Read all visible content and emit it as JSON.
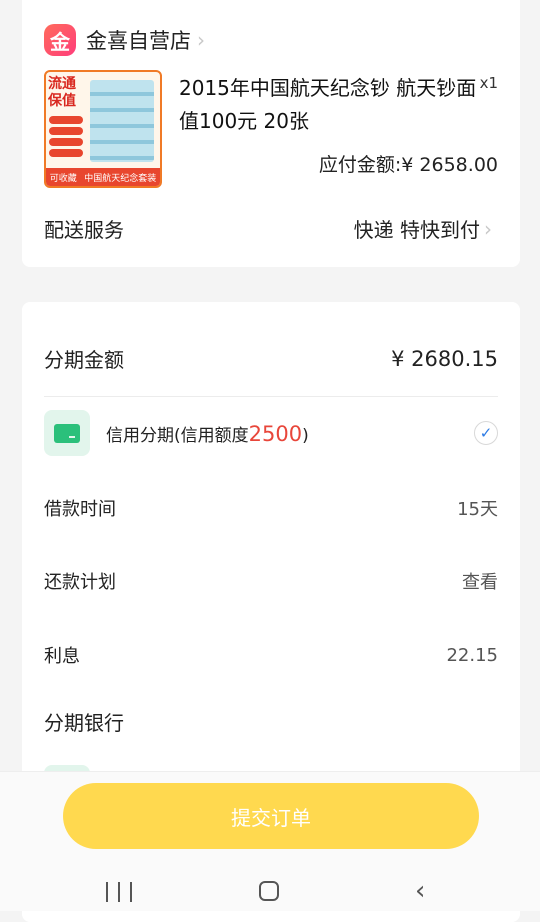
{
  "store": {
    "logo_char": "金",
    "name": "金喜自营店",
    "chevron": "›"
  },
  "product": {
    "image": {
      "headline": "流通保值",
      "bottom_left": "可收藏",
      "bottom_right": "中国航天纪念套装"
    },
    "title": "2015年中国航天纪念钞 航天钞面值100元 20张",
    "quantity": "x1",
    "price": "应付金额:¥ 2658.00"
  },
  "delivery": {
    "label": "配送服务",
    "value": "快递 特快到付",
    "chevron": "›"
  },
  "installment": {
    "amount_label": "分期金额",
    "amount_value": "¥ 2680.15",
    "credit_prefix": "信用分期(信用额度",
    "credit_limit": "2500",
    "credit_suffix": ")",
    "check": "✓",
    "rows": [
      {
        "label": "借款时间",
        "value": "15天"
      },
      {
        "label": "还款计划",
        "value": "查看"
      },
      {
        "label": "利息",
        "value": "22.15"
      }
    ],
    "bank_label": "分期银行"
  },
  "submit": {
    "label": "提交订单",
    "color": "#ffd94f"
  },
  "nav": {
    "back_glyph": "‹"
  }
}
